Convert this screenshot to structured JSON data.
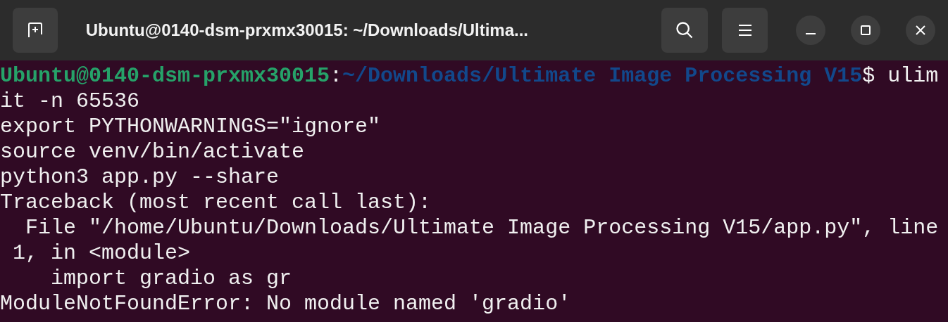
{
  "window": {
    "title": "Ubuntu@0140-dsm-prxmx30015: ~/Downloads/Ultima..."
  },
  "terminal": {
    "lines": [
      {
        "kind": "prompt",
        "user": "Ubuntu@0140-dsm-prxmx30015",
        "separator": ":",
        "path": "~/Downloads/Ultimate Image Processing V15",
        "sign": "$",
        "command": " ulim"
      },
      {
        "kind": "output",
        "text": "it -n 65536"
      },
      {
        "kind": "output",
        "text": "export PYTHONWARNINGS=\"ignore\""
      },
      {
        "kind": "output",
        "text": "source venv/bin/activate"
      },
      {
        "kind": "output",
        "text": "python3 app.py --share"
      },
      {
        "kind": "output",
        "text": "Traceback (most recent call last):"
      },
      {
        "kind": "output",
        "text": "  File \"/home/Ubuntu/Downloads/Ultimate Image Processing V15/app.py\", line"
      },
      {
        "kind": "output",
        "text": " 1, in <module>"
      },
      {
        "kind": "output",
        "text": "    import gradio as gr"
      },
      {
        "kind": "output",
        "text": "ModuleNotFoundError: No module named 'gradio'"
      }
    ]
  }
}
